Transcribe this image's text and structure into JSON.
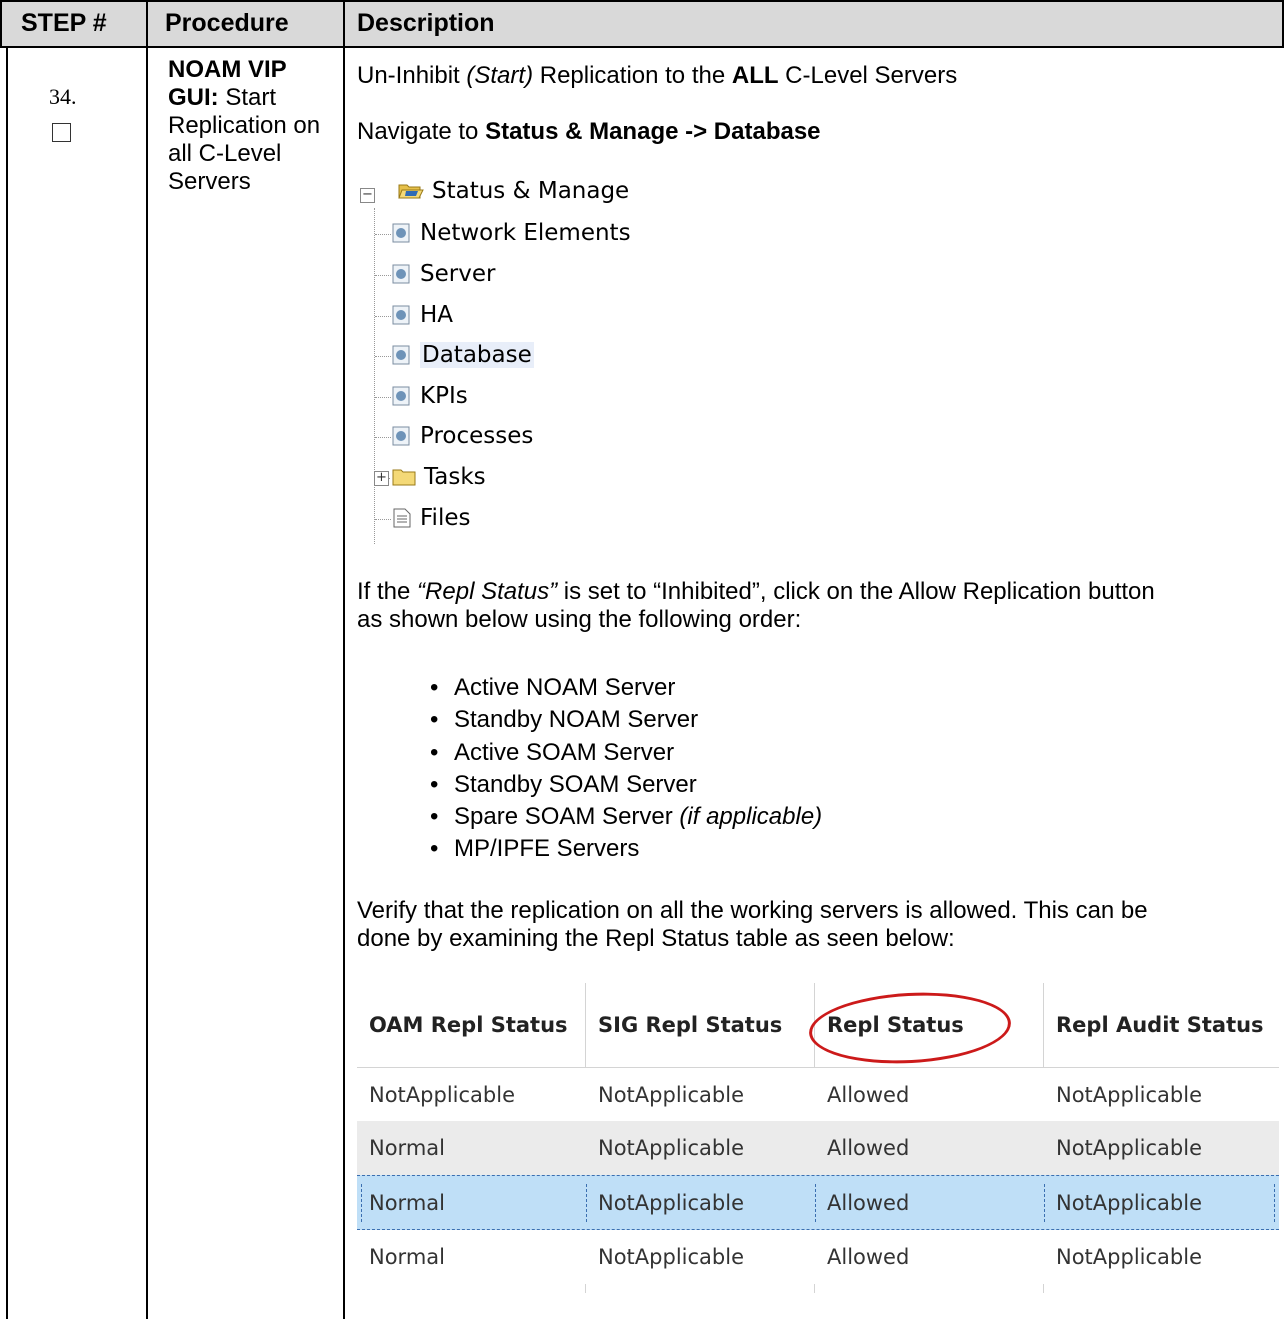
{
  "header": {
    "step": "STEP #",
    "procedure": "Procedure",
    "description": "Description"
  },
  "step": {
    "number": "34.",
    "checkbox_checked": false,
    "procedure_bold": "NOAM VIP GUI:",
    "procedure_rest": "Start Replication on all C-Level Servers"
  },
  "description": {
    "line1": {
      "a": "Un-Inhibit ",
      "b_italic": "(Start)",
      "c": " Replication to the ",
      "d_bold": "ALL",
      "e": " C-Level Servers"
    },
    "line2": {
      "a": "Navigate to ",
      "b_bold": "Status & Manage -> Database"
    },
    "para1": {
      "a": "If the ",
      "b_italic": "“Repl Status”",
      "c": " is set to “Inhibited”, click on the Allow Replication button",
      "d": "as shown below using the following order:"
    },
    "bullets": [
      {
        "text": "Active NOAM Server",
        "italic": ""
      },
      {
        "text": "Standby NOAM Server",
        "italic": ""
      },
      {
        "text": "Active SOAM Server",
        "italic": ""
      },
      {
        "text": "Standby SOAM Server",
        "italic": ""
      },
      {
        "text": "Spare SOAM Server ",
        "italic": "(if applicable)"
      },
      {
        "text": "MP/IPFE Servers",
        "italic": ""
      }
    ],
    "para2": {
      "a": "Verify that the replication on all the working servers is allowed. This can be",
      "b": "done by examining the Repl Status table as seen below:"
    }
  },
  "tree": {
    "root": {
      "label": "Status & Manage",
      "expander": "−",
      "icon": "open-folder-icon"
    },
    "children": [
      {
        "label": "Network Elements",
        "icon": "page-icon"
      },
      {
        "label": "Server",
        "icon": "page-icon"
      },
      {
        "label": "HA",
        "icon": "page-icon"
      },
      {
        "label": "Database",
        "icon": "page-icon",
        "selected": true
      },
      {
        "label": "KPIs",
        "icon": "page-icon"
      },
      {
        "label": "Processes",
        "icon": "page-icon"
      },
      {
        "label": "Tasks",
        "icon": "folder-icon",
        "expander": "+"
      },
      {
        "label": "Files",
        "icon": "file-icon"
      }
    ]
  },
  "repl_table": {
    "columns": [
      "OAM Repl Status",
      "SIG Repl Status",
      "Repl Status",
      "Repl Audit Status"
    ],
    "rows": [
      [
        "NotApplicable",
        "NotApplicable",
        "Allowed",
        "NotApplicable"
      ],
      [
        "Normal",
        "NotApplicable",
        "Allowed",
        "NotApplicable"
      ],
      [
        "Normal",
        "NotApplicable",
        "Allowed",
        "NotApplicable"
      ],
      [
        "Normal",
        "NotApplicable",
        "Allowed",
        "NotApplicable"
      ]
    ],
    "row_backgrounds": [
      "#ffffff",
      "#ebebeb",
      "#bfdff7",
      "#ffffff"
    ],
    "selected_row": 2,
    "highlight_color": "#cc1a1a"
  }
}
